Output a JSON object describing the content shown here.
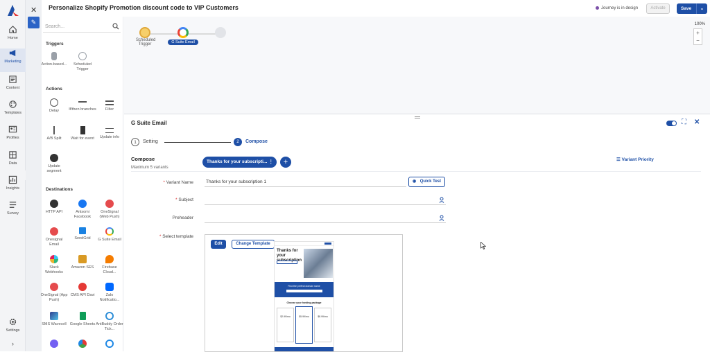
{
  "nav": {
    "items": [
      {
        "label": "Home",
        "icon": "home-icon"
      },
      {
        "label": "Marketing",
        "icon": "megaphone-icon"
      },
      {
        "label": "Content",
        "icon": "content-icon"
      },
      {
        "label": "Templates",
        "icon": "palette-icon"
      },
      {
        "label": "Profiles",
        "icon": "profile-icon"
      },
      {
        "label": "Data",
        "icon": "database-icon"
      },
      {
        "label": "Insights",
        "icon": "chart-icon"
      },
      {
        "label": "Survey",
        "icon": "survey-icon"
      },
      {
        "label": "Settings",
        "icon": "gear-icon"
      }
    ],
    "collapse_glyph": "›",
    "expander_glyph": "»"
  },
  "palette": {
    "close_glyph": "✕",
    "pencil_glyph": "✎",
    "search_placeholder": "Search...",
    "triggers_heading": "Triggers",
    "triggers": [
      "Action-based...",
      "Scheduled Trigger"
    ],
    "actions_heading": "Actions",
    "actions": [
      "Delay",
      "If/then branches",
      "Filter",
      "A/B Split",
      "Wait for event",
      "Update info",
      "Update segment"
    ],
    "destinations_heading": "Destinations",
    "destinations": [
      "HTTP API",
      "Antsomi Facebook",
      "OneSignal (Web Push)",
      "Onesignal Email",
      "SendGrid",
      "G Suite Email",
      "Slack Webhooks",
      "Amazon SES",
      "Firebase Cloud...",
      "OneSignal (App Push)",
      "CMS API Davi",
      "Zalo Notificatio...",
      "SMS Wavecell",
      "Google Sheets",
      "AntBuddy Order Tick..."
    ]
  },
  "topbar": {
    "title": "Personalize Shopify Promotion discount code to VIP Customers",
    "status": "Journey is in design",
    "status_color": "#7b4fa8",
    "activate": "Activate",
    "save": "Save",
    "save_dropdown_glyph": "⌄"
  },
  "canvas": {
    "nodes": [
      {
        "label": "Scheduled Trigger"
      },
      {
        "label": "G Suite Email"
      }
    ],
    "zoom": "100%",
    "zoom_in": "+",
    "zoom_out": "−"
  },
  "panel": {
    "title": "G Suite Email",
    "expand_glyph": "⛶",
    "close_glyph": "✕",
    "steps": [
      {
        "num": "1",
        "label": "Setting"
      },
      {
        "num": "2",
        "label": "Compose"
      }
    ],
    "compose_title": "Compose",
    "compose_sub": "Maximum 5 variants",
    "variant_tab": "Thanks for your subscripti...",
    "variant_menu_glyph": "⋮",
    "add_glyph": "+",
    "variant_priority": "Variant Priority",
    "fields": {
      "variant_name_label": "Variant Name",
      "variant_name_value": "Thanks for your subscription 1",
      "subject_label": "Subject",
      "subject_value": "",
      "preheader_label": "Preheader",
      "preheader_value": "",
      "template_label": "Select template",
      "required_mark": "*"
    },
    "quick_test": "Quick Test",
    "edit": "Edit",
    "change_template": "Change Template",
    "preview": {
      "headline": "Thanks for your subscription",
      "banner": "Find the perfect domain name",
      "section": "Choose your hosting package",
      "prices": [
        "$2.99/mo",
        "$5.99/mo",
        "$8.99/mo"
      ]
    }
  }
}
